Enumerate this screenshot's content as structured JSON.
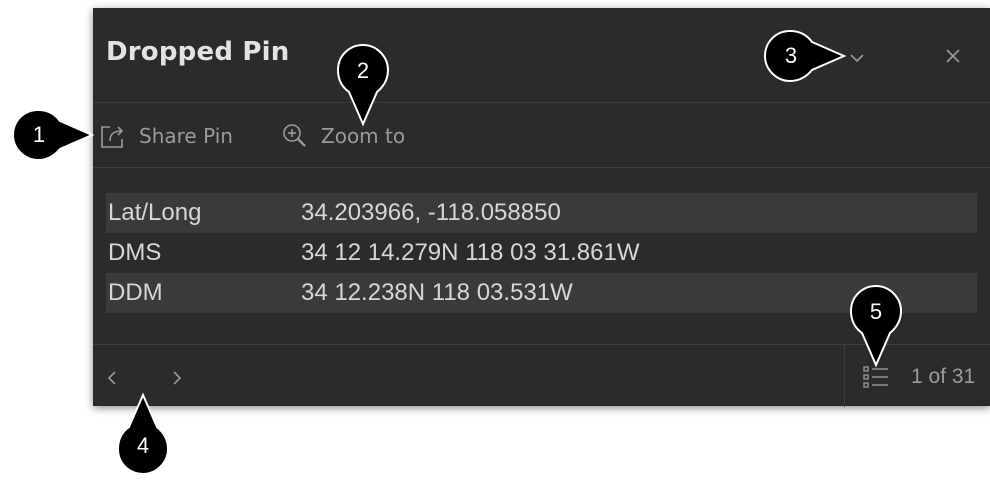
{
  "popup": {
    "title": "Dropped Pin",
    "icons": {
      "collapse": "chevron-down-icon",
      "close": "close-icon"
    }
  },
  "actions": {
    "share_label": "Share Pin",
    "zoom_label": "Zoom to",
    "icons": {
      "share": "share-icon",
      "zoom": "zoom-in-icon"
    }
  },
  "coordinates": [
    {
      "label": "Lat/Long",
      "value": "34.203966, -118.058850"
    },
    {
      "label": "DMS",
      "value": "34 12 14.279N 118 03 31.861W"
    },
    {
      "label": "DDM",
      "value": "34 12.238N 118 03.531W"
    }
  ],
  "footer": {
    "counter": "1 of 31",
    "icons": {
      "prev": "chevron-left-icon",
      "next": "chevron-right-icon",
      "list": "list-icon"
    }
  },
  "callouts": [
    "1",
    "2",
    "3",
    "4",
    "5"
  ],
  "colors": {
    "panel_bg": "#2b2b2b",
    "row_alt": "#3a3a3a",
    "text": "#d6d6d6",
    "muted": "#9a9a9a",
    "callout": "#000000"
  }
}
